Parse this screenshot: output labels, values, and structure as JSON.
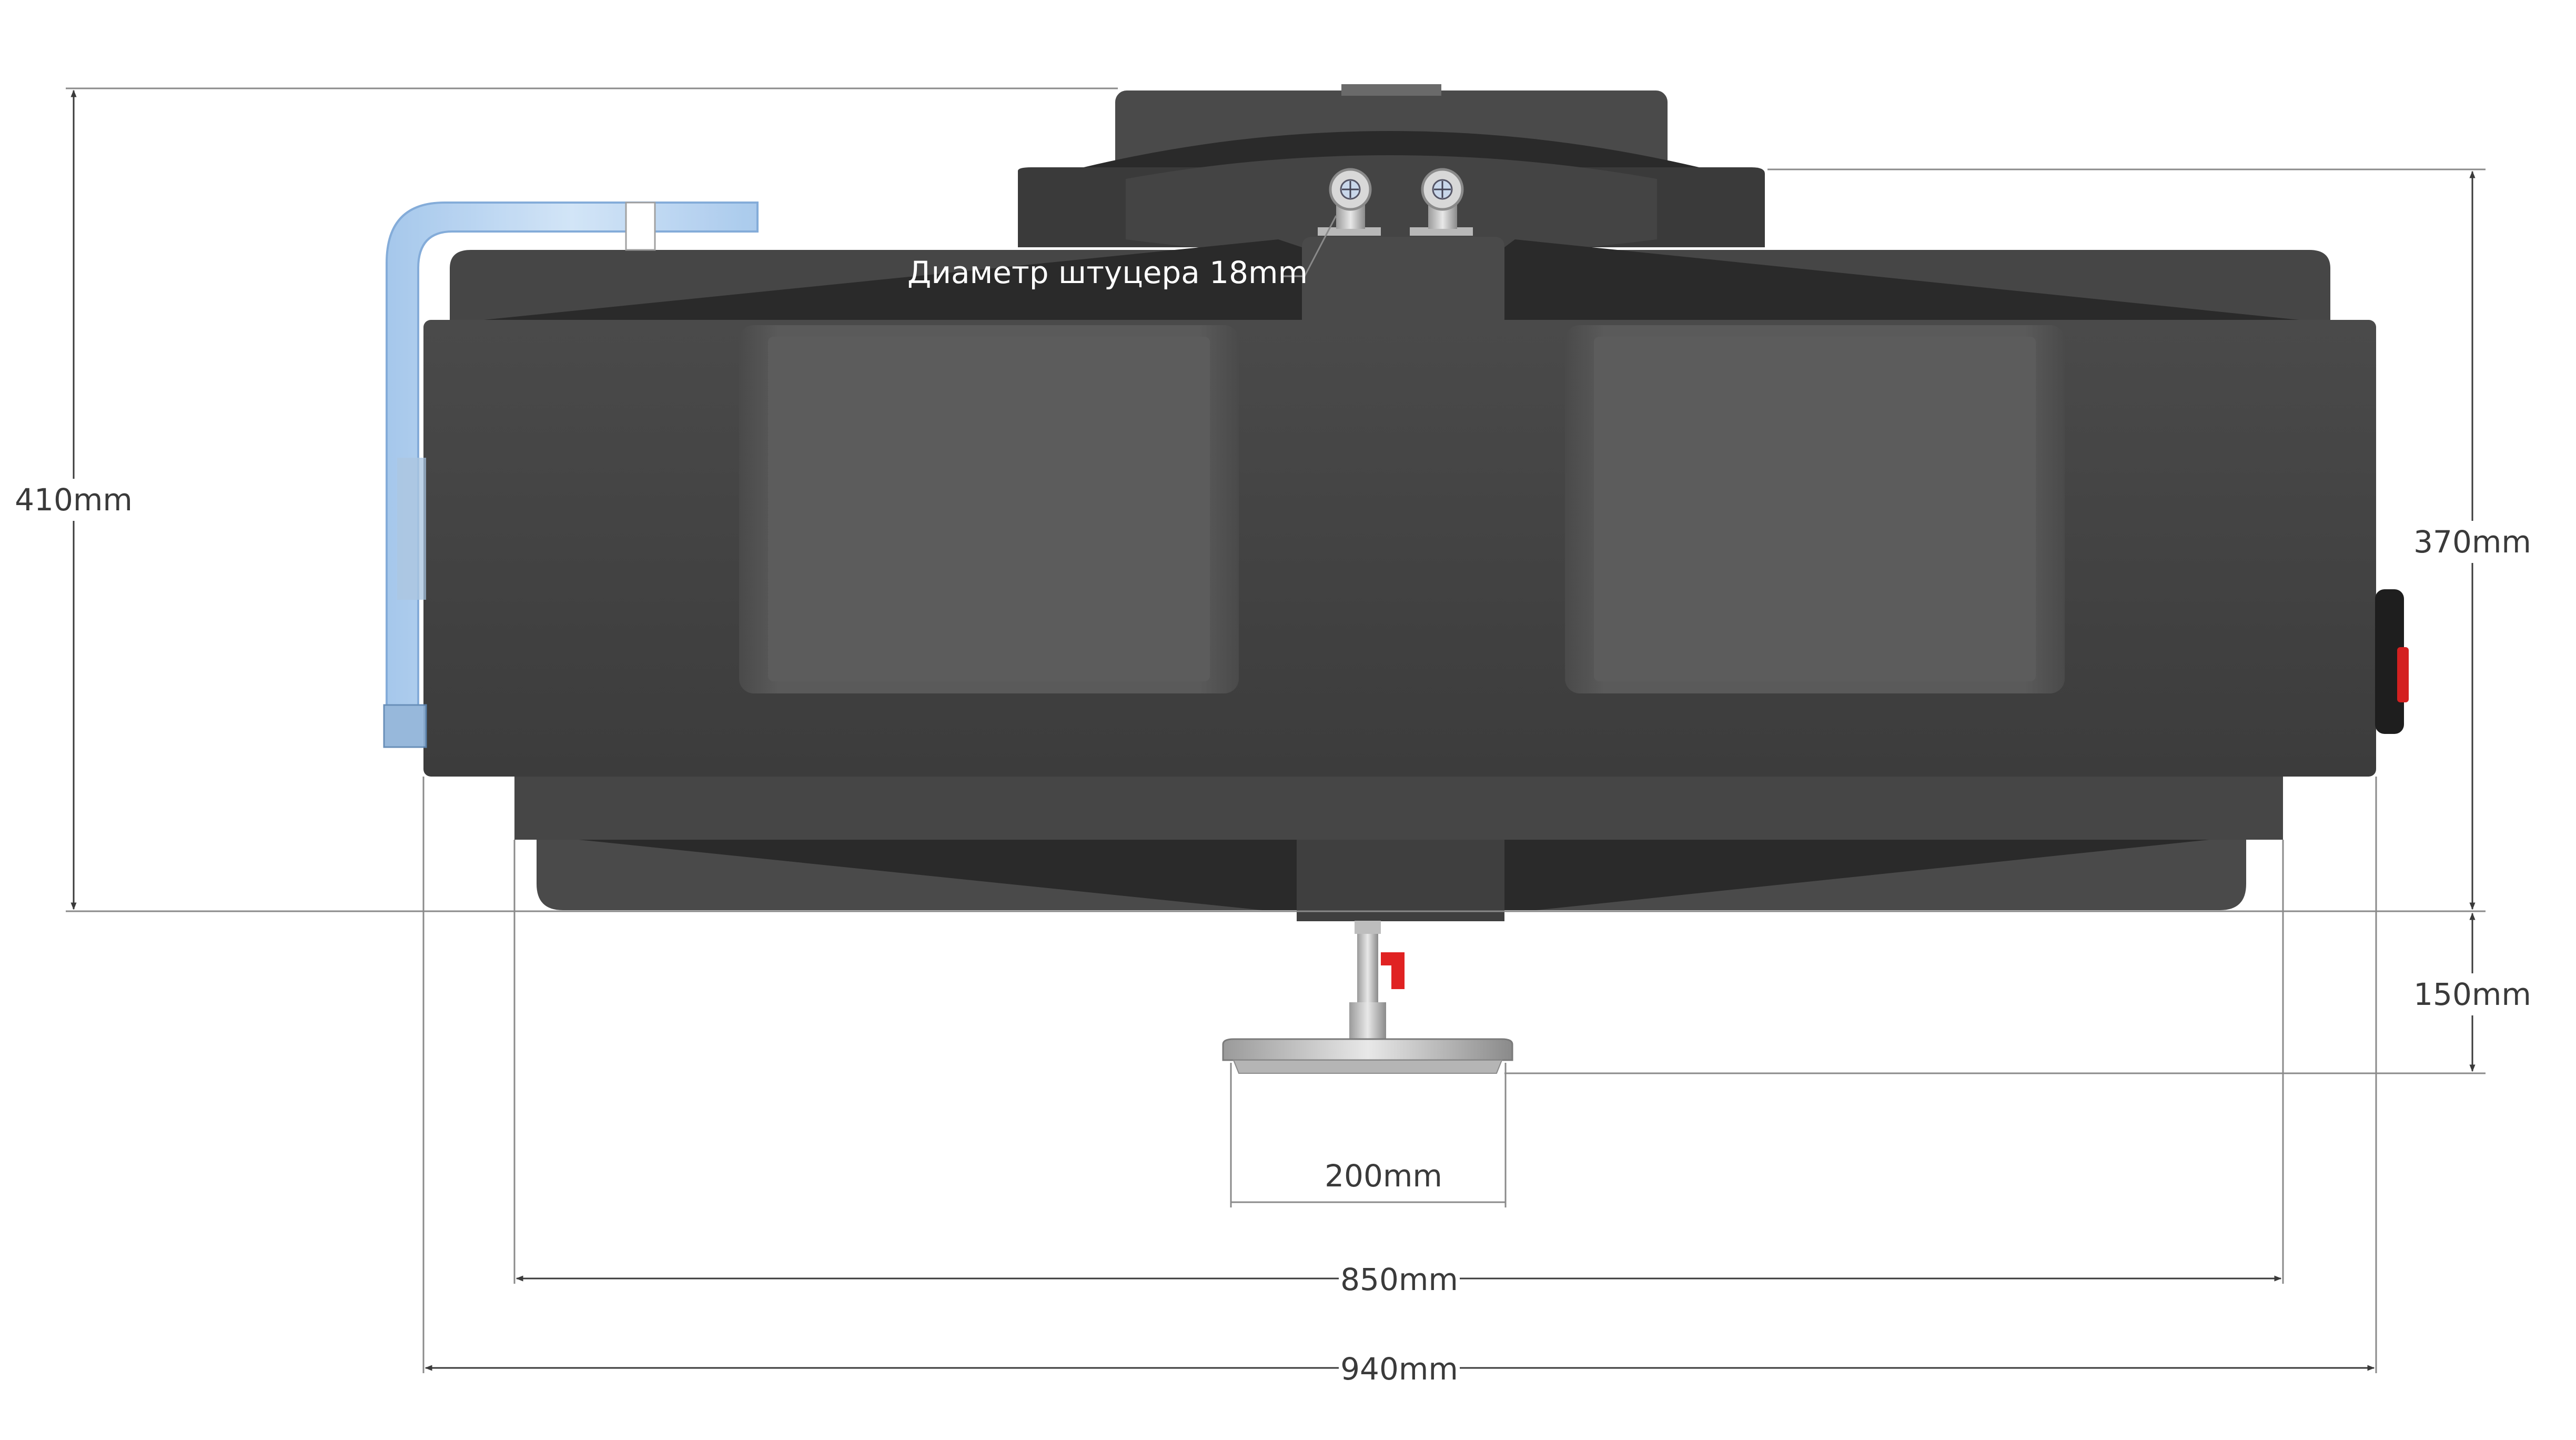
{
  "dimensions": {
    "total_height": "410mm",
    "body_height": "370mm",
    "shower_drop": "150mm",
    "shower_head_diameter": "200mm",
    "inner_width": "850mm",
    "outer_width": "940mm"
  },
  "annotations": {
    "fitting_diameter": "Диаметр штуцера 18mm"
  },
  "colors": {
    "tank_dark": "#2b2b2b",
    "tank_mid": "#454545",
    "tank_panel": "#565656",
    "hose_blue": "#b9d6f2",
    "tap_red": "#e02222",
    "dimension_line": "#8a8a8a"
  },
  "icons": {
    "fitting": "pipe-fitting-icon",
    "shower_head": "shower-head-icon",
    "valve": "valve-tap-icon",
    "filler_cap": "filler-cap-icon"
  }
}
